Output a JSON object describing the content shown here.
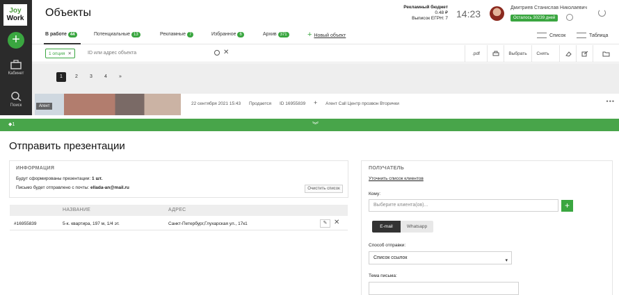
{
  "sidebar": {
    "logo_line1": "Joy",
    "logo_line2": "Work",
    "add_symbol": "+",
    "items": [
      {
        "label": "Кабинет",
        "icon": "cabinet-icon"
      },
      {
        "label": "Поиск",
        "icon": "search-icon"
      }
    ]
  },
  "header": {
    "title": "Объекты",
    "budget_label": "Рекламный бюджет",
    "budget_value": "0.48 ₽",
    "egrn": "Выписок ЕГРН: 7",
    "time": "14:23",
    "user_name": "Дмитриев Станислав Николаевич",
    "days_left": "Осталось 30239 дней"
  },
  "tabs": [
    {
      "label": "В работе",
      "count": "44"
    },
    {
      "label": "Потенциальные",
      "count": "13"
    },
    {
      "label": "Рекламные",
      "count": "7"
    },
    {
      "label": "Избранное",
      "count": "6"
    },
    {
      "label": "Архив",
      "count": "371"
    }
  ],
  "new_object": "Новый объект",
  "new_object_symbol": "+",
  "views": {
    "list": "Список",
    "table": "Таблица"
  },
  "filter": {
    "chip": "1 опция",
    "chip_x": "✕",
    "search_placeholder": "ID или адрес объекта",
    "clear": "✕",
    "buttons": {
      "pdf": ".pdf",
      "select": "Выбрать",
      "remove": "Снять"
    }
  },
  "pager": {
    "pages": [
      "1",
      "2",
      "3",
      "4",
      "»"
    ],
    "current": "1"
  },
  "card": {
    "agent": "Агент",
    "date": "22 сентября 2021  15:43",
    "status": "Продается",
    "id": "ID 16955839",
    "plus": "+",
    "agent_call": "Агент Call Центр прозвон Вторички",
    "dots": "•••"
  },
  "greenbar": {
    "badge": "◆1",
    "chevron": "︾"
  },
  "panel": {
    "title": "Отправить презентации",
    "info_header": "ИНФОРМАЦИЯ",
    "info_line1_prefix": "Будут сформированы презентации:",
    "info_line1_value": "1 шт.",
    "info_line2_prefix": "Письмо будет отправлено с почты:",
    "info_line2_value": "ellada-an@mail.ru",
    "clear_list": "Очистить список",
    "table": {
      "columns": [
        "НАЗВАНИЕ",
        "АДРЕС"
      ],
      "rows": [
        {
          "id": "#16955839",
          "name": "5-к. квартира, 197 м, 1/4 эт.",
          "address": "Санкт-Петербург,Глухарская ул., 17к1"
        }
      ],
      "edit": "✎",
      "delete": "✕"
    },
    "recipient_header": "ПОЛУЧАТЕЛЬ",
    "refine_link": "Уточнить список клиентов",
    "to_label": "Кому:",
    "client_placeholder": "Выберите клиента(ов)...",
    "add_client": "+",
    "channels": {
      "email": "E-mail",
      "whatsapp": "Whatsapp"
    },
    "method_label": "Способ отправки:",
    "method_value": "Список ссылок",
    "select_arrow": "▾",
    "subject_label": "Тема письма:"
  }
}
